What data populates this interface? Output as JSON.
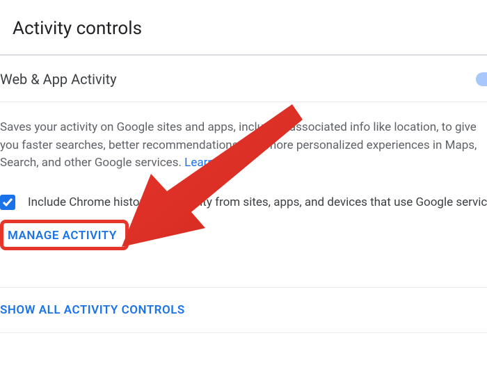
{
  "header": {
    "title": "Activity controls"
  },
  "section": {
    "title": "Web & App Activity",
    "toggle_on": true,
    "description": "Saves your activity on Google sites and apps, including associated info like location, to give you faster searches, better recommendations, and more personalized experiences in Maps, Search, and other Google services. ",
    "learn_more": "Learn more",
    "checkbox_checked": true,
    "checkbox_label": "Include Chrome history and activity from sites, apps, and devices that use Google services",
    "manage_activity": "MANAGE ACTIVITY"
  },
  "footer": {
    "show_all": "SHOW ALL ACTIVITY CONTROLS"
  },
  "colors": {
    "accent": "#1a73e8",
    "highlight": "#e6352b"
  }
}
